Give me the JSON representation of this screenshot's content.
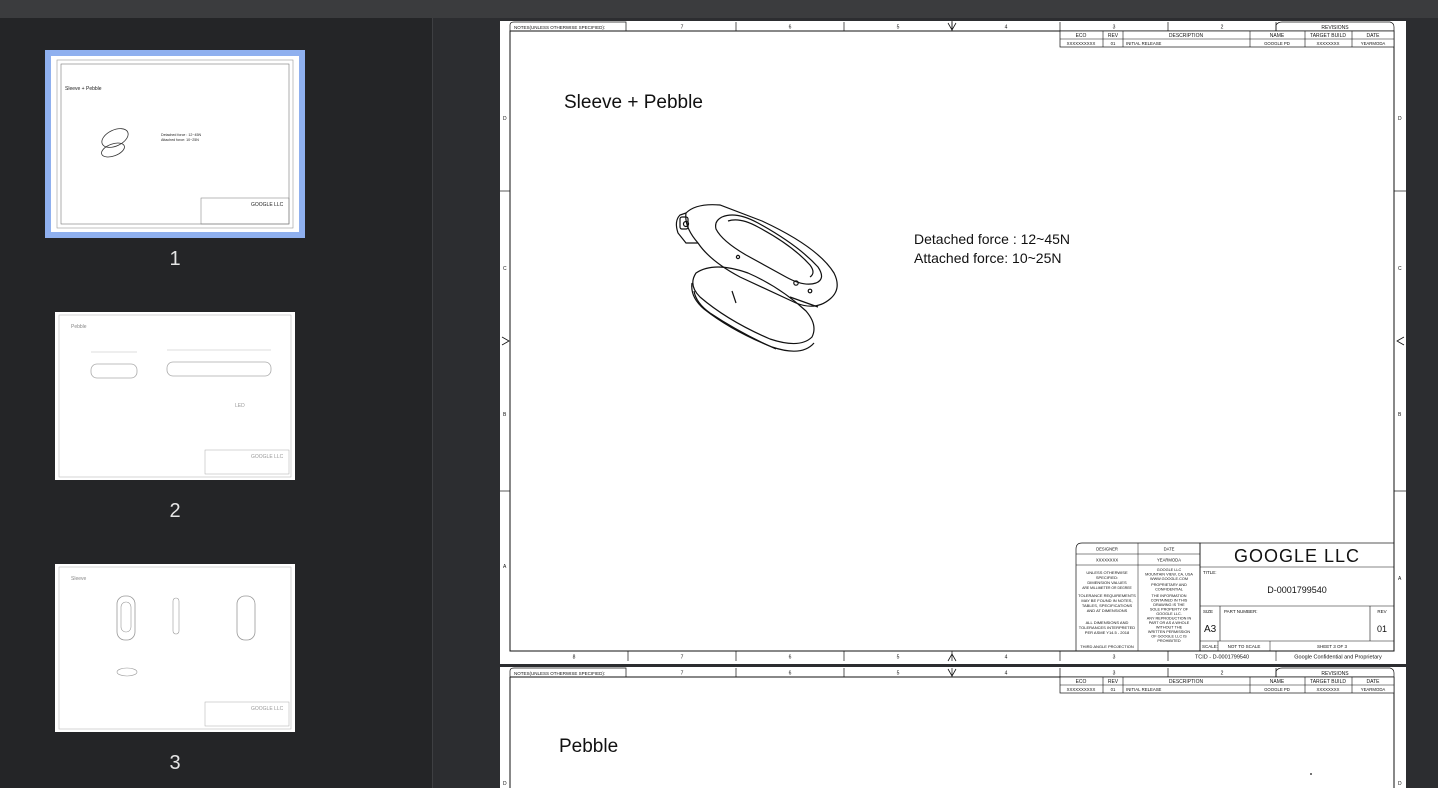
{
  "thumbnails": [
    {
      "number": "1",
      "title": "Sleeve + Pebble",
      "lines": [
        "Detached force : 12~45N",
        "Attached force: 10~25N"
      ],
      "company": "GOOGLE LLC"
    },
    {
      "number": "2",
      "title": "Pebble",
      "label": "LED",
      "company": "GOOGLE LLC"
    },
    {
      "number": "3",
      "title": "Sleeve",
      "company": "GOOGLE LLC"
    }
  ],
  "sheet1": {
    "notes": "NOTES(UNLESS OTHERWISE SPECIFIED):",
    "col_numbers": [
      "8",
      "7",
      "6",
      "5",
      "4",
      "3",
      "2"
    ],
    "row_letters": [
      "D",
      "C",
      "B",
      "A"
    ],
    "revisions": {
      "title": "REVISIONS",
      "headers": [
        "ECO",
        "REV",
        "DESCRIPTION",
        "NAME",
        "TARGET BUILD",
        "DATE"
      ],
      "row": [
        "XXXXXXXXXX",
        "01",
        "INITIAL RELEASE",
        "GOOGLE PD",
        "XXXXXXXX",
        "YEARMODA"
      ]
    },
    "drawing_title": "Sleeve + Pebble",
    "annotation_line1": "Detached force : 12~45N",
    "annotation_line2": "Attached force: 10~25N",
    "title_block": {
      "designer_label": "DESIGNER",
      "date_label": "DATE",
      "designer_value": "XXXXXXXX",
      "date_value": "YEARMODA",
      "company": "GOOGLE LLC",
      "address": [
        "GOOGLE LLC",
        "MOUNTAIN VIEW, CA, USA",
        "WWW.GOOGLE.COM"
      ],
      "proprietary": [
        "PROPRIETARY AND",
        "CONFIDENTIAL"
      ],
      "unless": [
        "UNLESS OTHERWISE",
        "SPECIFIED:",
        "DIMENSION VALUES",
        "ARE MILLIMETER OR DEGREE"
      ],
      "tolerance": [
        "TOLERANCE REQUIREMENTS",
        "MAY BE FOUND IN NOTES,",
        "TABLES, SPECIFICATIONS",
        "AND AT DIMENSIONS"
      ],
      "info": [
        "THE INFORMATION",
        "CONTAINED IN THIS",
        "DRAWING IS THE",
        "SOLE PROPERTY OF",
        "GOOGLE LLC.",
        "ANY REPRODUCTION IN",
        "PART OR AS A WHOLE",
        "WITHOUT THE",
        "WRITTEN PERMISSION",
        "OF GOOGLE LLC IS",
        "PROHIBITED"
      ],
      "dims": [
        "ALL DIMENSIONS AND",
        "TOLERANCES INTERPRETED",
        "PER ASME Y14.5 - 2018"
      ],
      "projection": "THIRD ANGLE PROJECTION",
      "title_label": "TITLE:",
      "title_value": "D-0001799540",
      "size_label": "SIZE",
      "size_value": "A3",
      "part_label": "PART NUMBER:",
      "rev_label": "REV",
      "rev_value": "01",
      "scale_label": "SCALE:",
      "scale_value": "NOT TO SCALE",
      "sheet_label": "SHEET 3 OF 3",
      "tcid": "TCID - D-0001799540",
      "confidential": "Google Confidential and Proprietary"
    }
  },
  "sheet2": {
    "notes": "NOTES(UNLESS OTHERWISE SPECIFIED):",
    "drawing_title": "Pebble",
    "col_numbers": [
      "7",
      "6",
      "5",
      "4",
      "3",
      "2"
    ],
    "row_letter": "D",
    "revisions": {
      "title": "REVISIONS",
      "headers": [
        "ECO",
        "REV",
        "DESCRIPTION",
        "NAME",
        "TARGET BUILD",
        "DATE"
      ],
      "row": [
        "XXXXXXXXXX",
        "01",
        "INITIAL RELEASE",
        "GOOGLE PD",
        "XXXXXXXX",
        "YEARMODA"
      ]
    }
  }
}
